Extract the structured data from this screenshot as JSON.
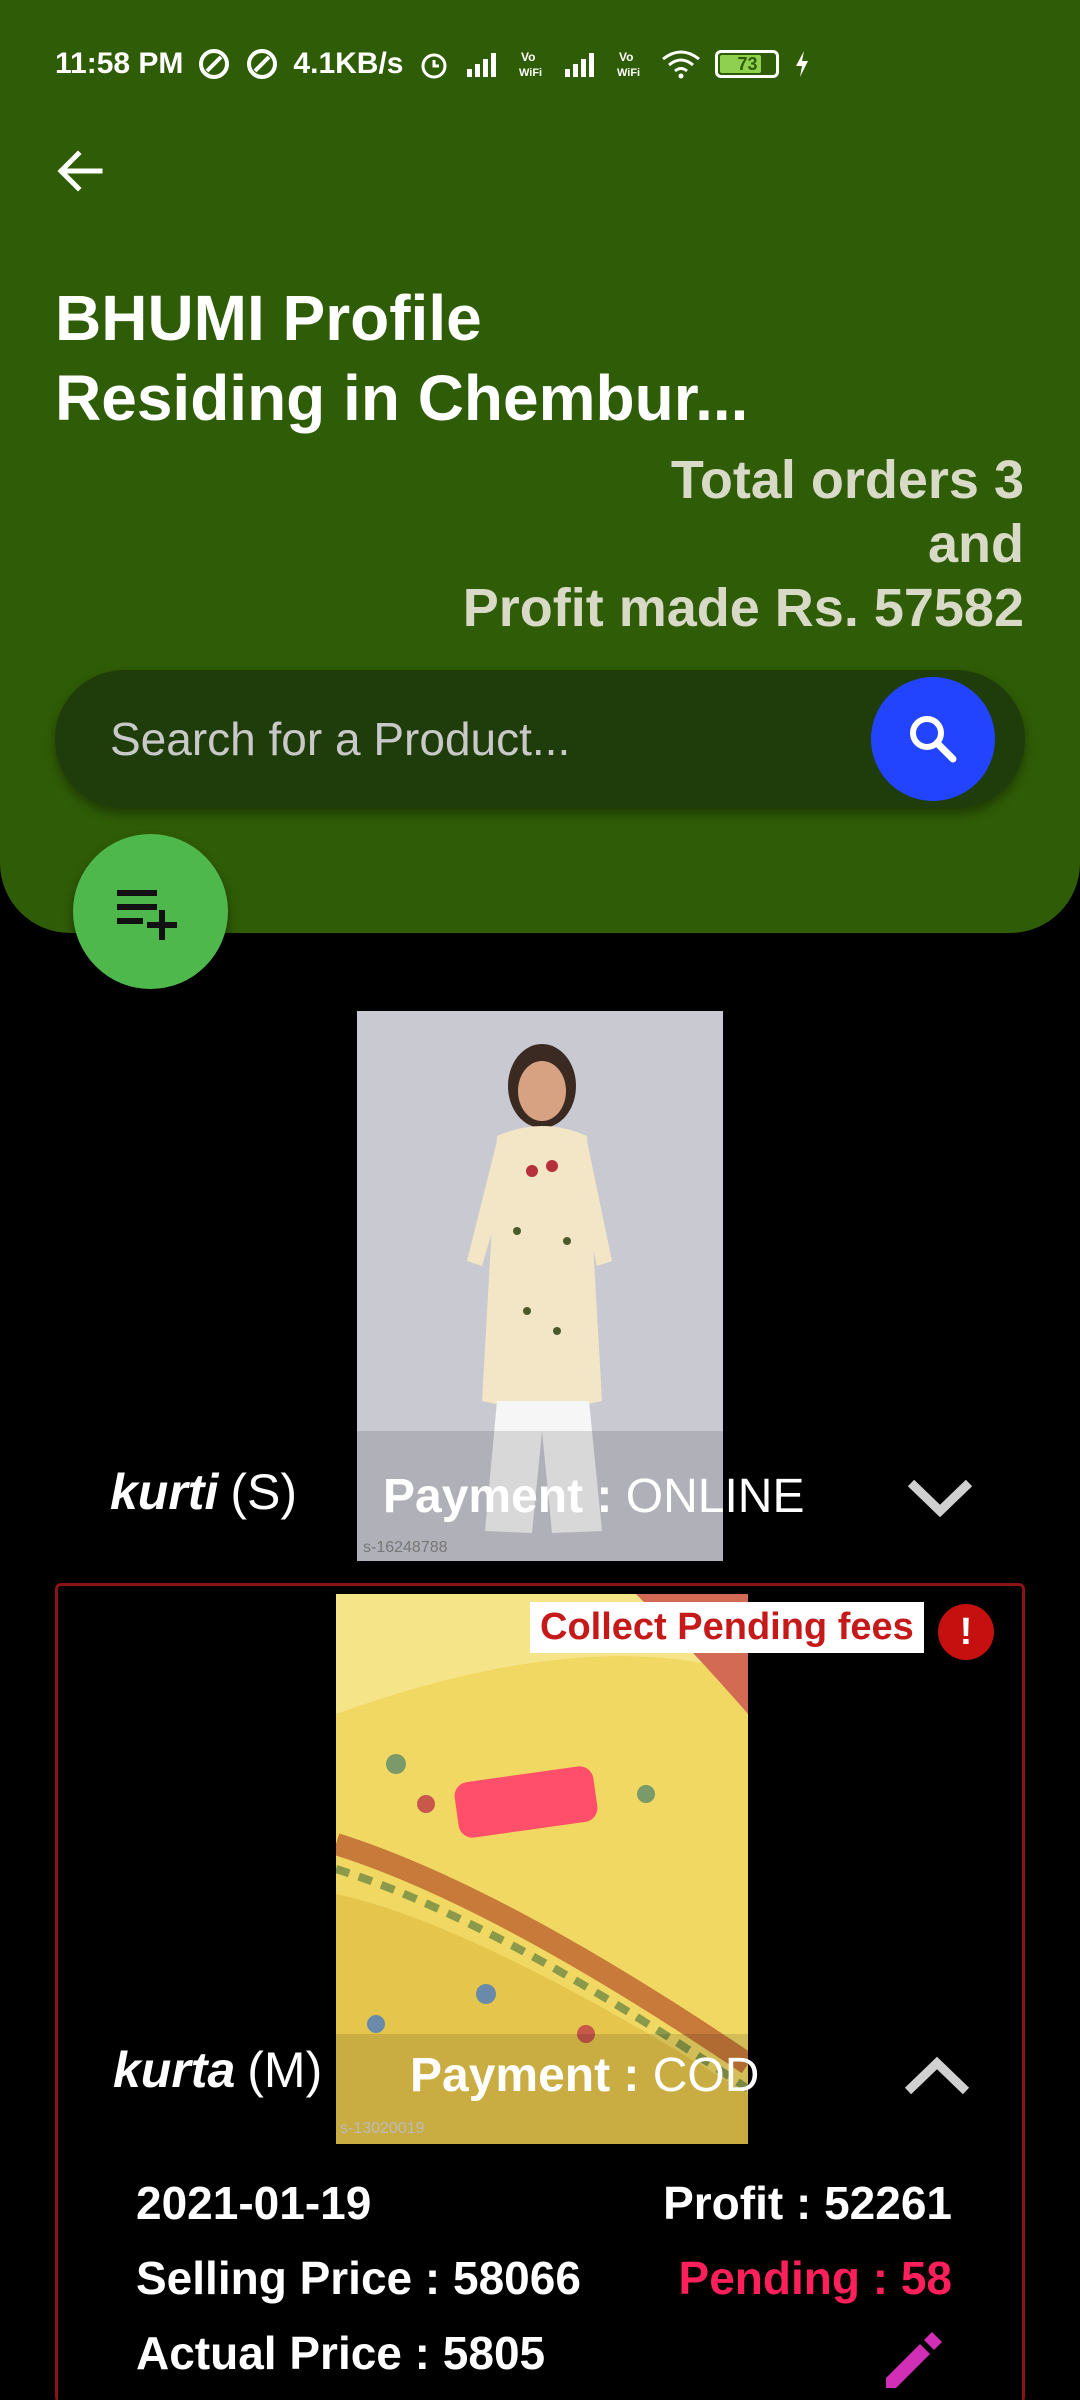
{
  "status_bar": {
    "time": "11:58 PM",
    "speed": "4.1KB/s",
    "battery": "73",
    "icons": [
      "sync-icon",
      "sync-icon",
      "alarm-icon",
      "signal-icon",
      "wifi-calling-icon",
      "signal-icon",
      "wifi-calling-icon",
      "wifi-icon",
      "battery-icon",
      "charging-icon"
    ]
  },
  "header": {
    "title_line1": "BHUMI Profile",
    "title_line2": "Residing in Chembur...",
    "orders_line1": "Total orders 3",
    "orders_line2": "and",
    "orders_line3": "Profit made Rs. 57582"
  },
  "search": {
    "placeholder": "Search for a Product..."
  },
  "products": [
    {
      "name": "kurti",
      "size": "(S)",
      "payment_label": "Payment : ",
      "payment_value": "ONLINE",
      "sku": "s-16248788"
    },
    {
      "name": "kurta",
      "size": "(M)",
      "payment_label": "Payment : ",
      "payment_value": "COD",
      "sku": "s-13020019",
      "alert": "Collect Pending fees",
      "date": "2021-01-19",
      "profit": "Profit : 52261",
      "selling_price": "Selling Price : 58066",
      "pending": "Pending : 58",
      "actual_price": "Actual Price : 5805"
    }
  ],
  "colors": {
    "header_bg": "#2f5c06",
    "search_button": "#2244ff",
    "fab": "#4fb84c",
    "pending": "#ff1f5a",
    "alert_border": "#8d1414",
    "edit_icon": "#d12fb6"
  }
}
